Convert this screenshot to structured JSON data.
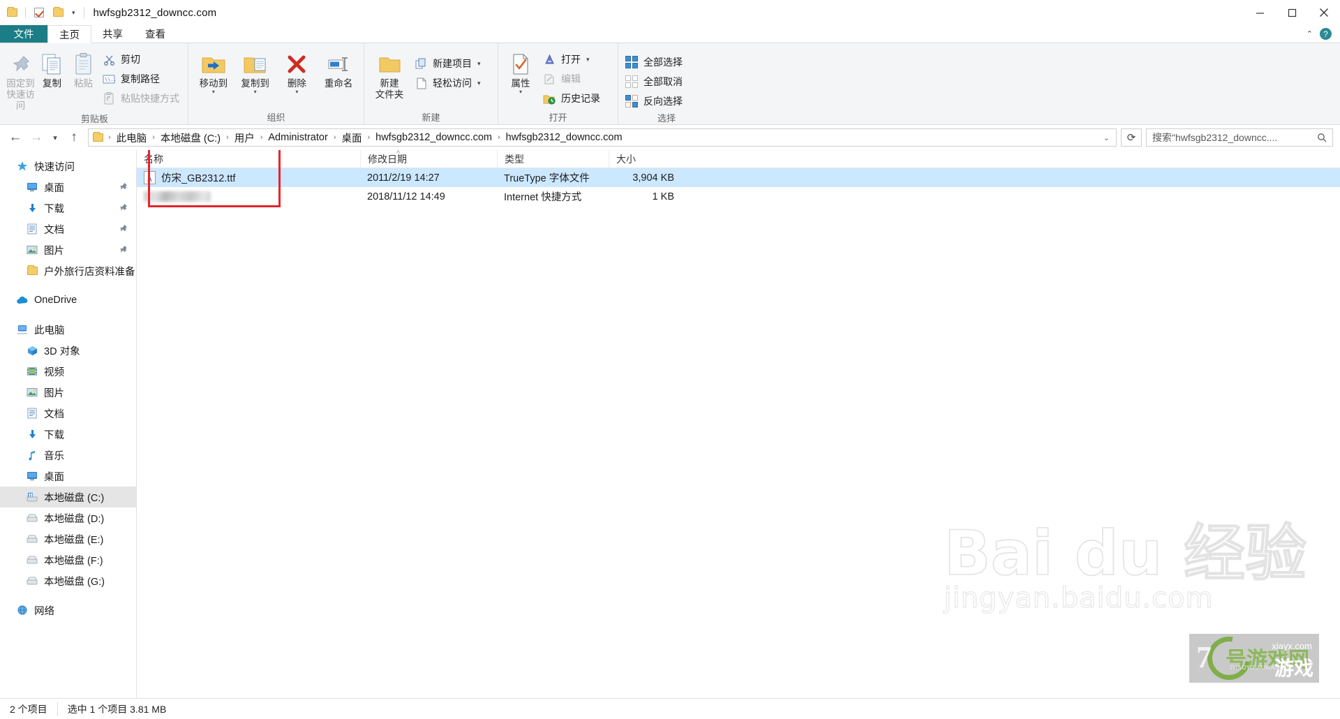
{
  "window": {
    "title": "hwfsgb2312_downcc.com",
    "quick_access_icons": [
      "folder-icon",
      "properties-check-icon",
      "new-folder-icon",
      "customize-caret-icon"
    ],
    "minimize": "minimize-icon",
    "maximize": "maximize-icon",
    "close": "close-icon"
  },
  "tabs": [
    {
      "label": "文件",
      "kind": "file"
    },
    {
      "label": "主页",
      "kind": "active"
    },
    {
      "label": "共享",
      "kind": "normal"
    },
    {
      "label": "查看",
      "kind": "normal"
    }
  ],
  "ribbon": {
    "collapse_caret": "⌃",
    "help": "?",
    "groups": [
      {
        "label": "剪贴板",
        "big": [
          {
            "label_line1": "固定到",
            "label_line2": "快速访问",
            "icon": "pin-icon",
            "disabled": true
          },
          {
            "label_line1": "复制",
            "label_line2": "",
            "icon": "copy-icon",
            "disabled": false
          },
          {
            "label_line1": "粘贴",
            "label_line2": "",
            "icon": "paste-icon",
            "disabled": true
          }
        ],
        "small": [
          {
            "label": "剪切",
            "icon": "scissors-icon",
            "disabled": false
          },
          {
            "label": "复制路径",
            "icon": "copy-path-icon",
            "disabled": false
          },
          {
            "label": "粘贴快捷方式",
            "icon": "paste-shortcut-icon",
            "disabled": true
          }
        ]
      },
      {
        "label": "组织",
        "big": [
          {
            "label_line1": "移动到",
            "label_line2": "",
            "icon": "move-to-icon",
            "caret": true
          },
          {
            "label_line1": "复制到",
            "label_line2": "",
            "icon": "copy-to-icon",
            "caret": true
          },
          {
            "label_line1": "删除",
            "label_line2": "",
            "icon": "delete-icon",
            "caret": true
          },
          {
            "label_line1": "重命名",
            "label_line2": "",
            "icon": "rename-icon",
            "caret": false
          }
        ],
        "small": []
      },
      {
        "label": "新建",
        "big": [
          {
            "label_line1": "新建",
            "label_line2": "文件夹",
            "icon": "new-folder-icon",
            "disabled": false
          }
        ],
        "small": [
          {
            "label": "新建项目",
            "icon": "new-item-icon",
            "caret": true
          },
          {
            "label": "轻松访问",
            "icon": "easy-access-icon",
            "caret": true
          }
        ]
      },
      {
        "label": "打开",
        "big": [
          {
            "label_line1": "属性",
            "label_line2": "",
            "icon": "properties-icon",
            "caret": true
          }
        ],
        "small": [
          {
            "label": "打开",
            "icon": "open-icon",
            "caret": true
          },
          {
            "label": "编辑",
            "icon": "edit-icon",
            "disabled": true
          },
          {
            "label": "历史记录",
            "icon": "history-icon"
          }
        ]
      },
      {
        "label": "选择",
        "big": [],
        "small": [
          {
            "label": "全部选择",
            "icon": "select-all-icon"
          },
          {
            "label": "全部取消",
            "icon": "select-none-icon"
          },
          {
            "label": "反向选择",
            "icon": "invert-selection-icon"
          }
        ]
      }
    ]
  },
  "address": {
    "back_icon": "back-arrow-icon",
    "forward_icon": "forward-arrow-icon",
    "recent_icon": "recent-caret-icon",
    "up_icon": "up-arrow-icon",
    "breadcrumbs": [
      "此电脑",
      "本地磁盘 (C:)",
      "用户",
      "Administrator",
      "桌面",
      "hwfsgb2312_downcc.com",
      "hwfsgb2312_downcc.com"
    ],
    "separator": "›",
    "dropdown_icon": "chevron-down-icon",
    "refresh_icon": "refresh-icon",
    "search_placeholder": "搜索\"hwfsgb2312_downcc....",
    "search_icon": "search-icon"
  },
  "sidebar": {
    "sections": [
      {
        "header": {
          "label": "快速访问",
          "icon": "star-icon"
        },
        "items": [
          {
            "label": "桌面",
            "icon": "desktop-icon",
            "pinned": true
          },
          {
            "label": "下载",
            "icon": "download-icon",
            "pinned": true
          },
          {
            "label": "文档",
            "icon": "documents-icon",
            "pinned": true
          },
          {
            "label": "图片",
            "icon": "pictures-icon",
            "pinned": true
          },
          {
            "label": "户外旅行店资料准备",
            "icon": "folder-icon",
            "pinned": false
          }
        ]
      },
      {
        "header": {
          "label": "OneDrive",
          "icon": "cloud-icon"
        },
        "items": []
      },
      {
        "header": {
          "label": "此电脑",
          "icon": "this-pc-icon"
        },
        "items": [
          {
            "label": "3D 对象",
            "icon": "3d-objects-icon",
            "selected": false
          },
          {
            "label": "视频",
            "icon": "videos-icon",
            "selected": false
          },
          {
            "label": "图片",
            "icon": "pictures-icon",
            "selected": false
          },
          {
            "label": "文档",
            "icon": "documents-icon",
            "selected": false
          },
          {
            "label": "下载",
            "icon": "download-icon",
            "selected": false
          },
          {
            "label": "音乐",
            "icon": "music-icon",
            "selected": false
          },
          {
            "label": "桌面",
            "icon": "desktop-icon",
            "selected": false
          },
          {
            "label": "本地磁盘 (C:)",
            "icon": "system-drive-icon",
            "selected": true
          },
          {
            "label": "本地磁盘 (D:)",
            "icon": "drive-icon",
            "selected": false
          },
          {
            "label": "本地磁盘 (E:)",
            "icon": "drive-icon",
            "selected": false
          },
          {
            "label": "本地磁盘 (F:)",
            "icon": "drive-icon",
            "selected": false
          },
          {
            "label": "本地磁盘 (G:)",
            "icon": "drive-icon",
            "selected": false
          }
        ]
      },
      {
        "header": {
          "label": "网络",
          "icon": "network-icon"
        },
        "items": []
      }
    ]
  },
  "filelist": {
    "columns": [
      {
        "key": "name",
        "label": "名称",
        "sorted": true,
        "sort_dir": "asc"
      },
      {
        "key": "date",
        "label": "修改日期"
      },
      {
        "key": "type",
        "label": "类型"
      },
      {
        "key": "size",
        "label": "大小"
      }
    ],
    "rows": [
      {
        "name": "仿宋_GB2312.ttf",
        "date": "2011/2/19 14:27",
        "type": "TrueType 字体文件",
        "size": "3,904 KB",
        "icon": "font-file-icon",
        "selected": true,
        "redacted": false
      },
      {
        "name": "",
        "date": "2018/11/12 14:49",
        "type": "Internet 快捷方式",
        "size": "1 KB",
        "icon": "internet-shortcut-icon",
        "selected": false,
        "redacted": true
      }
    ],
    "highlight_box": {
      "color": "#e8232a"
    }
  },
  "statusbar": {
    "item_count": "2 个项目",
    "selection": "选中 1 个项目  3.81 MB"
  },
  "watermarks": {
    "baidu_main": "Bai du 经验",
    "baidu_sub": "jingyan.baidu.com",
    "game_number": "7",
    "game_cn": "号游戏网",
    "game_cn2": "游戏",
    "game_domain": "xiayx.com",
    "game_pinyin": "7HAOYOUXIWANG"
  }
}
